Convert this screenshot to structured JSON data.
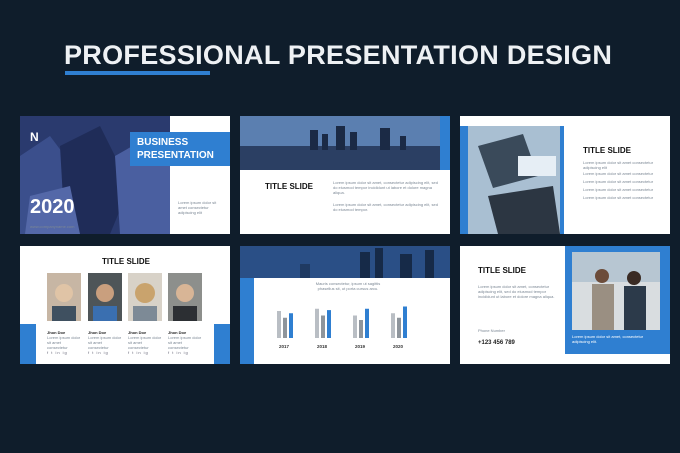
{
  "headline": "PROFESSIONAL PRESENTATION DESIGN",
  "colors": {
    "background": "#0f1d2b",
    "accent": "#2f7fd1",
    "slide": "#ffffff"
  },
  "slide1": {
    "logo": "N",
    "title_line1": "BUSINESS",
    "title_line2": "PRESENTATION",
    "year": "2020",
    "body": "Lorem ipsum dolor sit amet consectetur adipiscing elit",
    "website": "www.companyname.com"
  },
  "slide2": {
    "title": "TITLE SLIDE",
    "body1": "Lorem ipsum dolor sit amet, consectetur adipiscing elit, sed do eiusmod tempor incididunt ut labore et dolore magna aliqua.",
    "body2": "Lorem ipsum dolor sit amet, consectetur adipiscing elit, sed do eiusmod tempor."
  },
  "slide3": {
    "title": "TITLE SLIDE",
    "intro": "Lorem ipsum dolor sit amet consectetur adipiscing elit",
    "bullets": [
      "Lorem ipsum dolor sit amet consectetur",
      "Lorem ipsum dolor sit amet consectetur",
      "Lorem ipsum dolor sit amet consectetur",
      "Lorem ipsum dolor sit amet consectetur"
    ]
  },
  "slide4": {
    "title": "TITLE SLIDE",
    "people": [
      {
        "name": "Jhon Doe",
        "desc": "Lorem ipsum dolor sit amet consectetur",
        "social": "f  t  in  ig"
      },
      {
        "name": "Jhon Doe",
        "desc": "Lorem ipsum dolor sit amet consectetur",
        "social": "f  t  in  ig"
      },
      {
        "name": "Jhon Doe",
        "desc": "Lorem ipsum dolor sit amet consectetur",
        "social": "f  t  in  ig"
      },
      {
        "name": "Jhon Doe",
        "desc": "Lorem ipsum dolor sit amet consectetur",
        "social": "f  t  in  ig"
      }
    ]
  },
  "slide5": {
    "caption": "Mauris consectetur, ipsum ut sagittis phasellus sit, ut porta cursus arcu.",
    "chart_data": {
      "type": "bar",
      "categories": [
        "2017",
        "2018",
        "2019",
        "2020"
      ],
      "series": [
        {
          "values": [
            60,
            65,
            50,
            55
          ]
        },
        {
          "values": [
            45,
            50,
            40,
            45
          ]
        },
        {
          "values": [
            55,
            62,
            65,
            70
          ]
        }
      ],
      "series_colors": [
        "#b9bec4",
        "#8e959c",
        "#2f7fd1"
      ]
    }
  },
  "slide6": {
    "title": "TITLE SLIDE",
    "body": "Lorem ipsum dolor sit amet, consectetur adipiscing elit, sed do eiusmod tempor incididunt ut labore et dolore magna aliqua.",
    "phone_label": "Phone Number",
    "phone": "+123 456 789",
    "panel_text": "Lorem ipsum dolor sit amet, consectetur adipiscing elit."
  }
}
